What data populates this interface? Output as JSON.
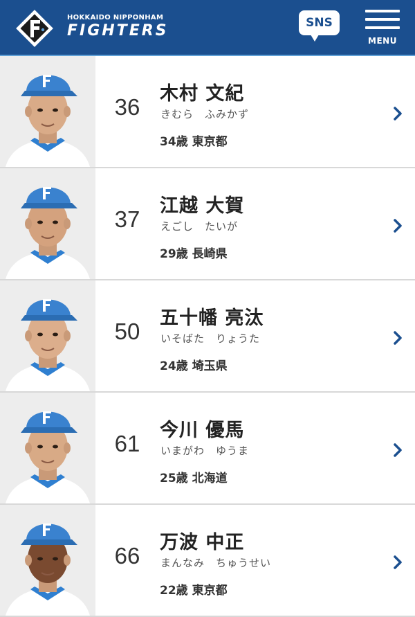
{
  "header": {
    "team_small": "HOKKAIDO NIPPONHAM",
    "team_big": "FIGHTERS",
    "sns_label": "SNS",
    "menu_label": "MENU",
    "colors": {
      "bar": "#1b4f8f",
      "accent": "#5fa0d6"
    }
  },
  "players": [
    {
      "number": "36",
      "name": "木村 文紀",
      "kana": "きむら　ふみかず",
      "info": "34歳 東京都"
    },
    {
      "number": "37",
      "name": "江越 大賀",
      "kana": "えごし　たいが",
      "info": "29歳 長崎県"
    },
    {
      "number": "50",
      "name": "五十幡 亮汰",
      "kana": "いそばた　りょうた",
      "info": "24歳 埼玉県"
    },
    {
      "number": "61",
      "name": "今川 優馬",
      "kana": "いまがわ　ゆうま",
      "info": "25歳 北海道"
    },
    {
      "number": "66",
      "name": "万波 中正",
      "kana": "まんなみ　ちゅうせい",
      "info": "22歳 東京都"
    }
  ]
}
